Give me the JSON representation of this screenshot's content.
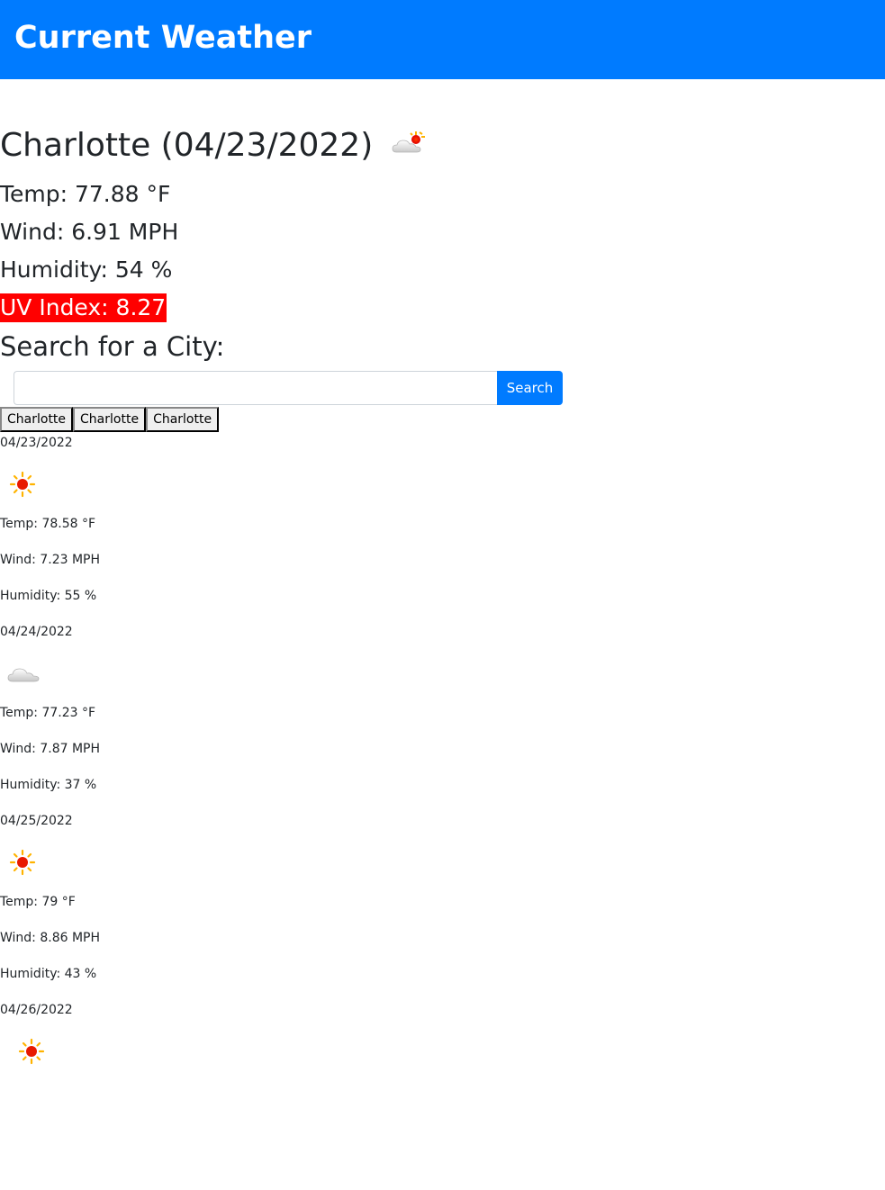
{
  "header": {
    "title": "Current Weather"
  },
  "current": {
    "city_date": "Charlotte (04/23/2022)",
    "icon": "partly-cloudy-icon",
    "temp": "Temp: 77.88 °F",
    "wind": "Wind: 6.91 MPH",
    "humidity": "Humidity: 54 %",
    "uv": "UV Index: 8.27",
    "uv_color": "#ff0000"
  },
  "search": {
    "title": "Search for a City:",
    "input_value": "",
    "button_label": "Search"
  },
  "history": [
    {
      "label": "Charlotte"
    },
    {
      "label": "Charlotte"
    },
    {
      "label": "Charlotte"
    }
  ],
  "forecast": [
    {
      "date": "04/23/2022",
      "icon": "sun-icon",
      "temp": "Temp: 78.58 °F",
      "wind": "Wind: 7.23 MPH",
      "humidity": "Humidity: 55 %"
    },
    {
      "date": "04/24/2022",
      "icon": "cloud-icon",
      "temp": "Temp: 77.23 °F",
      "wind": "Wind: 7.87 MPH",
      "humidity": "Humidity: 37 %"
    },
    {
      "date": "04/25/2022",
      "icon": "sun-icon",
      "temp": "Temp: 79 °F",
      "wind": "Wind: 8.86 MPH",
      "humidity": "Humidity: 43 %"
    },
    {
      "date": "04/26/2022",
      "icon": "sun-icon"
    }
  ],
  "colors": {
    "brand": "#007bff",
    "uv_high": "#ff0000"
  }
}
